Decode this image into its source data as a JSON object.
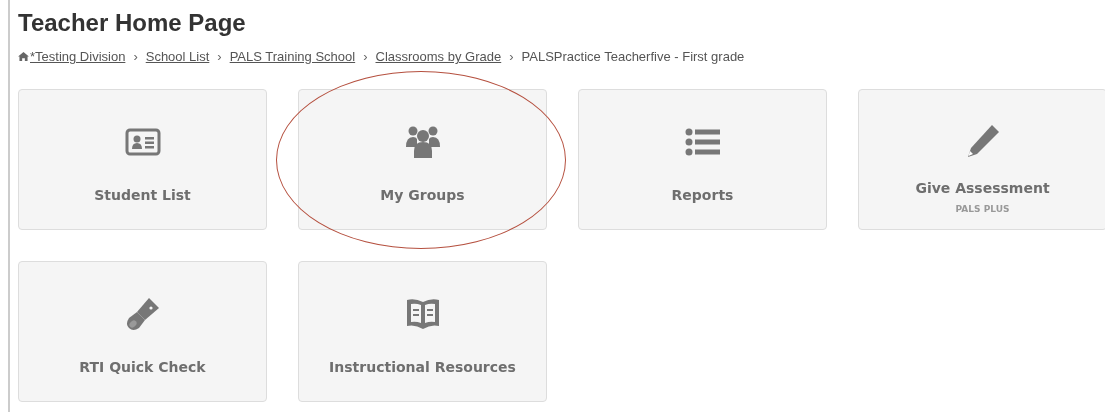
{
  "title": "Teacher Home Page",
  "breadcrumb": [
    {
      "label": "*Testing Division",
      "kind": "home"
    },
    {
      "label": "School List",
      "kind": "link",
      "separator": "›"
    },
    {
      "label": "PALS Training School",
      "kind": "link",
      "separator": "›"
    },
    {
      "label": "Classrooms by Grade",
      "kind": "link",
      "separator": "›"
    },
    {
      "label": "PALSPractice Teacherfive - First grade",
      "kind": "current",
      "separator": "›"
    }
  ],
  "tiles": [
    {
      "label": "Student List",
      "highlighted": false
    },
    {
      "label": "My Groups",
      "highlighted": true
    },
    {
      "label": "Reports",
      "highlighted": false
    },
    {
      "label": "Give Assessment",
      "subtitle": "PALS PLUS",
      "highlighted": false
    },
    {
      "label": "RTI Quick Check",
      "highlighted": false
    },
    {
      "label": "Instructional Resources",
      "highlighted": false
    }
  ]
}
